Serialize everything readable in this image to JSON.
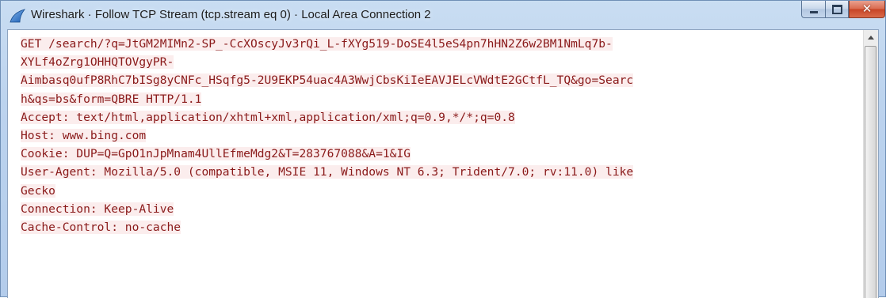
{
  "window": {
    "title": "Wireshark · Follow TCP Stream (tcp.stream eq 0) · Local Area Connection 2",
    "app_icon": "wireshark-fin-icon",
    "caption_buttons": [
      "minimize-icon",
      "maximize-icon",
      "close-icon"
    ],
    "close_glyph": "✕"
  },
  "colors": {
    "client_text": "#8a1a1a",
    "client_background": "#fbeded",
    "close_button": "#c74426"
  },
  "stream": {
    "lines": [
      "GET /search/?q=JtGM2MIMn2-SP_-CcXOscyJv3rQi_L-fXYg519-DoSE4l5eS4pn7hHN2Z6w2BM1NmLq7b-",
      "XYLf4oZrg1OHHQTOVgyPR-",
      "Aimbasq0ufP8RhC7bISg8yCNFc_HSqfg5-2U9EKP54uac4A3WwjCbsKiIeEAVJELcVWdtE2GCtfL_TQ&go=Searc",
      "h&qs=bs&form=QBRE HTTP/1.1",
      "Accept: text/html,application/xhtml+xml,application/xml;q=0.9,*/*;q=0.8",
      "Host: www.bing.com",
      "Cookie: DUP=Q=GpO1nJpMnam4UllEfmeMdg2&T=283767088&A=1&IG",
      "User-Agent: Mozilla/5.0 (compatible, MSIE 11, Windows NT 6.3; Trident/7.0; rv:11.0) like",
      "Gecko",
      "Connection: Keep-Alive",
      "Cache-Control: no-cache"
    ]
  }
}
